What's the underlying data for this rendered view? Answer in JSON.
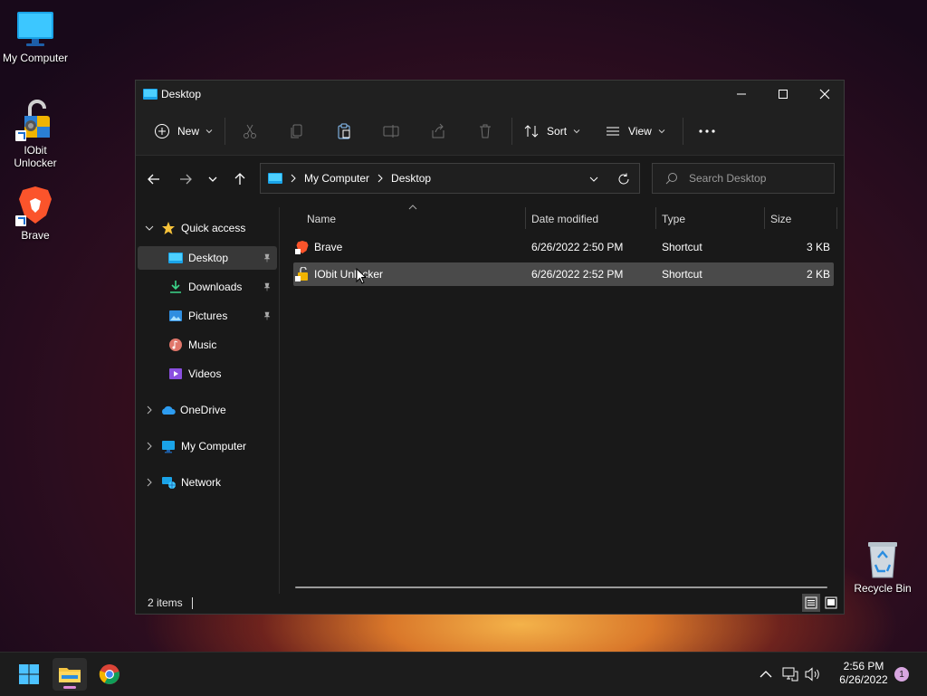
{
  "desktop": {
    "icons": [
      {
        "label": "My Computer"
      },
      {
        "label": "IObit Unlocker"
      },
      {
        "label": "Brave"
      },
      {
        "label": "Recycle Bin"
      }
    ]
  },
  "window": {
    "title": "Desktop",
    "commands": {
      "new_label": "New",
      "sort_label": "Sort",
      "view_label": "View"
    },
    "address": {
      "crumbs": [
        "My Computer",
        "Desktop"
      ],
      "search_placeholder": "Search Desktop"
    },
    "nav": {
      "quick_access": "Quick access",
      "items": [
        {
          "label": "Desktop",
          "pinned": true,
          "selected": true
        },
        {
          "label": "Downloads",
          "pinned": true
        },
        {
          "label": "Pictures",
          "pinned": true
        },
        {
          "label": "Music"
        },
        {
          "label": "Videos"
        }
      ],
      "onedrive": "OneDrive",
      "my_computer": "My Computer",
      "network": "Network"
    },
    "columns": {
      "name": "Name",
      "date": "Date modified",
      "type": "Type",
      "size": "Size"
    },
    "files": [
      {
        "name": "Brave",
        "date": "6/26/2022 2:50 PM",
        "type": "Shortcut",
        "size": "3 KB"
      },
      {
        "name": "IObit Unlocker",
        "date": "6/26/2022 2:52 PM",
        "type": "Shortcut",
        "size": "2 KB",
        "selected": true
      }
    ],
    "status": "2 items"
  },
  "taskbar": {
    "time": "2:56 PM",
    "date": "6/26/2022",
    "notification_count": "1"
  },
  "colors": {
    "accent": "#4cc2ff",
    "window_bg": "#191919",
    "selection": "#4a4a4a"
  }
}
